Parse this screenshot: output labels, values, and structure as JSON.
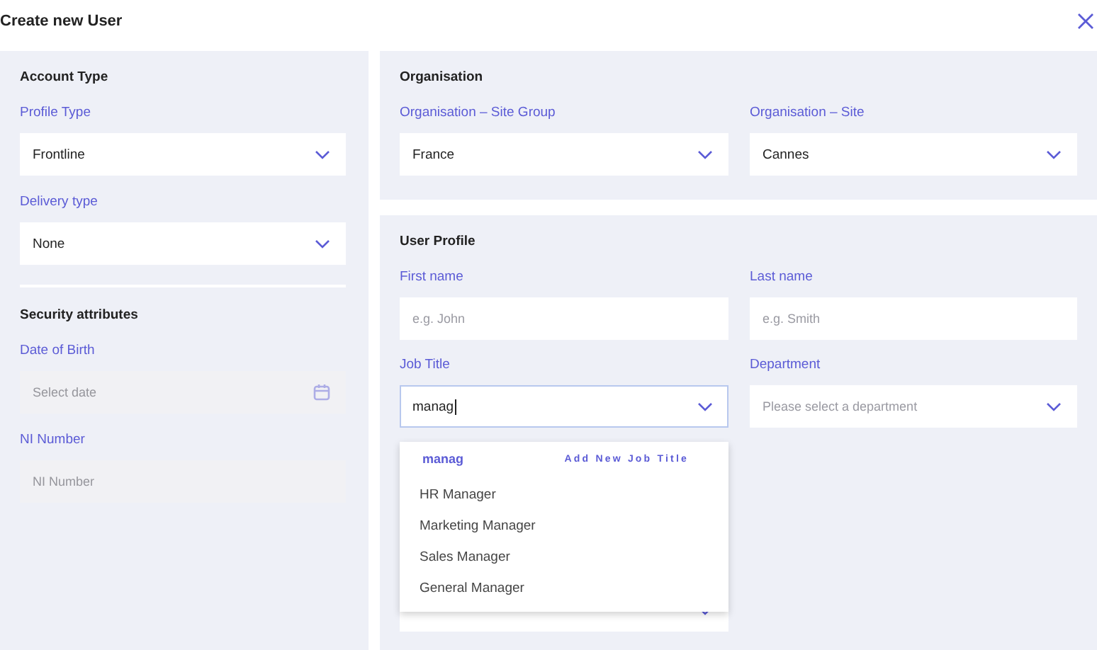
{
  "window": {
    "title": "Create new User"
  },
  "account": {
    "heading": "Account Type",
    "fields": [
      {
        "label": "Profile Type",
        "kind": "select",
        "value": "Frontline",
        "disabled": false
      },
      {
        "label": "Delivery type",
        "kind": "select",
        "value": "None",
        "disabled": false
      }
    ]
  },
  "security": {
    "heading": "Security attributes",
    "fields": [
      {
        "label": "Date of Birth",
        "kind": "date",
        "placeholder": "Select date",
        "disabled": true
      },
      {
        "label": "NI Number",
        "kind": "input",
        "placeholder": "NI Number",
        "disabled": true
      }
    ]
  },
  "organisation": {
    "heading": "Organisation",
    "fields": [
      {
        "label": "Organisation – Site Group",
        "kind": "select",
        "value": "France",
        "disabled": false
      },
      {
        "label": "Organisation – Site",
        "kind": "select",
        "value": "Cannes",
        "disabled": false
      }
    ]
  },
  "user_profile": {
    "heading": "User Profile",
    "fields": [
      {
        "label": "First name",
        "kind": "input",
        "placeholder": "e.g. John",
        "disabled": false
      },
      {
        "label": "Last name",
        "kind": "input",
        "placeholder": "e.g. Smith",
        "disabled": false
      },
      {
        "label": "Job Title",
        "kind": "select",
        "value": "manag",
        "disabled": false,
        "focused": true
      },
      {
        "label": "Department",
        "kind": "select",
        "placeholder": "Please select a department",
        "disabled": false
      }
    ],
    "dropdown": {
      "query": "manag",
      "add_action": "Add New Job Title",
      "options": [
        "HR Manager",
        "Marketing Manager",
        "Sales Manager",
        "General Manager"
      ]
    }
  }
}
